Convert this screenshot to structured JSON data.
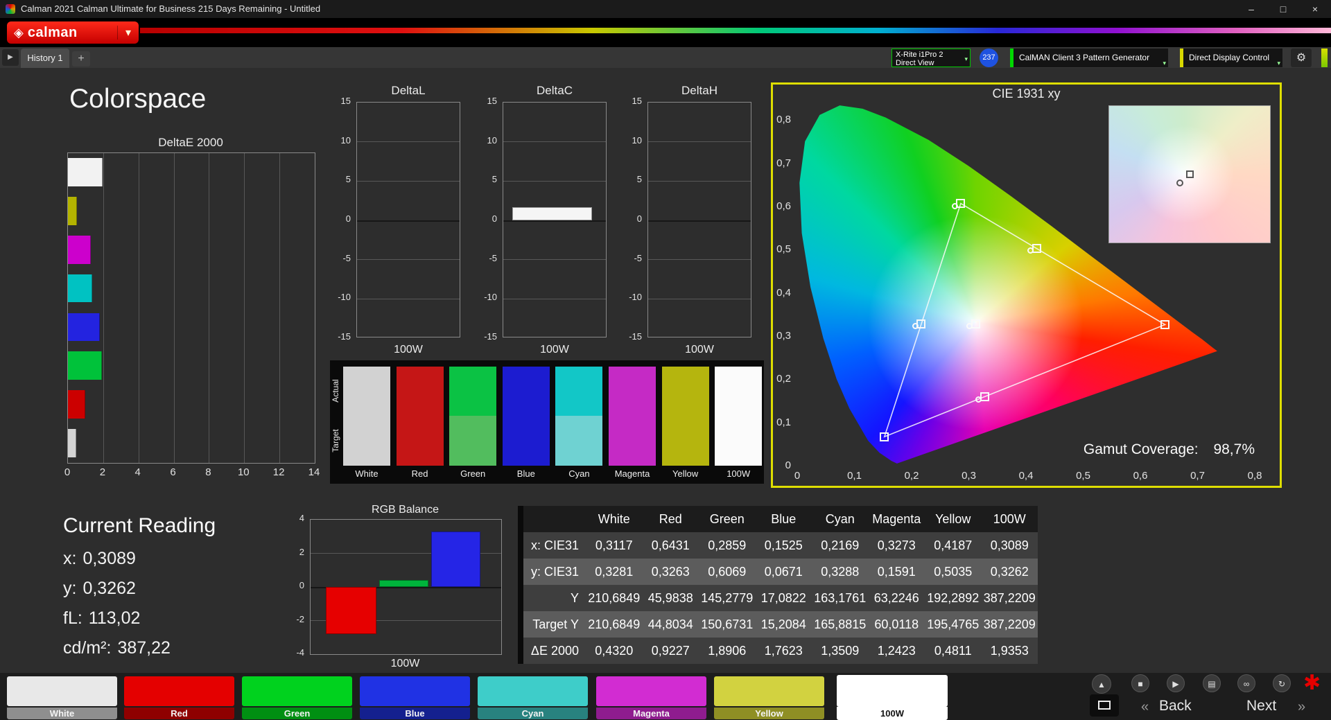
{
  "window": {
    "title": "Calman 2021 Calman Ultimate for Business 215 Days Remaining  - Untitled",
    "minimize": "–",
    "maximize": "□",
    "close": "×"
  },
  "brand": {
    "logo_text": "calman",
    "accent": "#e10600"
  },
  "tab_bar": {
    "history_tab": "History 1",
    "add_tab": "+"
  },
  "toolbar": {
    "meter_line1": "X-Rite i1Pro 2",
    "meter_line2": "Direct View",
    "badge": "237",
    "pattern_generator": "CalMAN Client 3 Pattern Generator",
    "display_control": "Direct Display Control"
  },
  "page": {
    "title": "Colorspace"
  },
  "icons": {
    "gem": "◈",
    "caret": "▾",
    "chevron": "▾",
    "gear": "⚙",
    "nav_arrow": "▶",
    "eject": "▲",
    "stop": "■",
    "play": "▶",
    "save": "▤",
    "link": "∞",
    "refresh": "↻",
    "asterisk": "✱",
    "back_chevrons": "«",
    "next_chevrons": "»"
  },
  "delta_e_chart": {
    "type": "bar",
    "title": "DeltaE 2000",
    "xlim": [
      0,
      14
    ],
    "xticks": [
      "0",
      "2",
      "4",
      "6",
      "8",
      "10",
      "12",
      "14"
    ],
    "bars": [
      {
        "name": "100W",
        "color": "#f2f2f2",
        "value": 1.9353
      },
      {
        "name": "Yellow",
        "color": "#b3b300",
        "value": 0.4811
      },
      {
        "name": "Magenta",
        "color": "#cc00cc",
        "value": 1.2423
      },
      {
        "name": "Cyan",
        "color": "#00c2c2",
        "value": 1.3509
      },
      {
        "name": "Blue",
        "color": "#2323e0",
        "value": 1.7623
      },
      {
        "name": "Green",
        "color": "#00c23a",
        "value": 1.8906
      },
      {
        "name": "Red",
        "color": "#cc0000",
        "value": 0.9227
      },
      {
        "name": "White",
        "color": "#d4d4d4",
        "value": 0.432
      }
    ]
  },
  "delta_charts": {
    "ylim": [
      -15,
      15
    ],
    "yticks": [
      "15",
      "10",
      "5",
      "0",
      "-5",
      "-10",
      "-15"
    ],
    "xlabel": "100W",
    "charts": [
      {
        "title": "DeltaL",
        "value": 0
      },
      {
        "title": "DeltaC",
        "value": 1.7
      },
      {
        "title": "DeltaH",
        "value": 0
      }
    ]
  },
  "swatch_compare": {
    "row_labels": [
      "Actual",
      "Target"
    ],
    "columns": [
      {
        "label": "White",
        "actual": "#d2d2d2",
        "target": "#d2d2d2"
      },
      {
        "label": "Red",
        "actual": "#c51616",
        "target": "#c51616"
      },
      {
        "label": "Green",
        "actual": "#0bc244",
        "target": "#52bd5e"
      },
      {
        "label": "Blue",
        "actual": "#1c1cd0",
        "target": "#1c1cd0"
      },
      {
        "label": "Cyan",
        "actual": "#12c7c7",
        "target": "#6fd2d2"
      },
      {
        "label": "Magenta",
        "actual": "#c52ac5",
        "target": "#c52ac5"
      },
      {
        "label": "Yellow",
        "actual": "#b5b50e",
        "target": "#b5b50e"
      },
      {
        "label": "100W",
        "actual": "#fbfbfb",
        "target": "#fbfbfb"
      }
    ]
  },
  "cie_chart": {
    "title": "CIE 1931 xy",
    "xticks": [
      "0",
      "0,1",
      "0,2",
      "0,3",
      "0,4",
      "0,5",
      "0,6",
      "0,7",
      "0,8"
    ],
    "yticks": [
      "0,8",
      "0,7",
      "0,6",
      "0,5",
      "0,4",
      "0,3",
      "0,2",
      "0,1",
      "0"
    ],
    "gamut_label": "Gamut Coverage:",
    "gamut_value": "98,7%",
    "points": [
      {
        "name": "white",
        "x": 0.3117,
        "y": 0.3281,
        "circle": true
      },
      {
        "name": "red",
        "x": 0.6431,
        "y": 0.3263,
        "circle": false
      },
      {
        "name": "green",
        "x": 0.2859,
        "y": 0.6069,
        "circle": true
      },
      {
        "name": "blue",
        "x": 0.1525,
        "y": 0.0671,
        "circle": false
      },
      {
        "name": "cyan",
        "x": 0.2169,
        "y": 0.3288,
        "circle": true
      },
      {
        "name": "magenta",
        "x": 0.3273,
        "y": 0.1591,
        "circle": true
      },
      {
        "name": "yellow",
        "x": 0.4187,
        "y": 0.5035,
        "circle": true
      }
    ],
    "triangle": [
      "red",
      "green",
      "blue"
    ]
  },
  "current_reading": {
    "title": "Current Reading",
    "lines": [
      {
        "label": "x:",
        "value": "0,3089"
      },
      {
        "label": "y:",
        "value": "0,3262"
      },
      {
        "label": "fL:",
        "value": "113,02"
      },
      {
        "label": "cd/m²:",
        "value": "387,22"
      }
    ]
  },
  "rgb_balance": {
    "type": "bar",
    "title": "RGB Balance",
    "ylim": [
      -4,
      4
    ],
    "yticks": [
      "4",
      "2",
      "0",
      "-2",
      "-4"
    ],
    "xlabel": "100W",
    "bars": [
      {
        "name": "red",
        "color": "#e60000",
        "value": -2.8
      },
      {
        "name": "green",
        "color": "#00b43c",
        "value": 0.4
      },
      {
        "name": "blue",
        "color": "#2525e6",
        "value": 3.3
      }
    ]
  },
  "measurement_table": {
    "columns": [
      "White",
      "Red",
      "Green",
      "Blue",
      "Cyan",
      "Magenta",
      "Yellow",
      "100W"
    ],
    "rows": [
      {
        "label": "x: CIE31",
        "values": [
          "0,3117",
          "0,6431",
          "0,2859",
          "0,1525",
          "0,2169",
          "0,3273",
          "0,4187",
          "0,3089"
        ]
      },
      {
        "label": "y: CIE31",
        "values": [
          "0,3281",
          "0,3263",
          "0,6069",
          "0,0671",
          "0,3288",
          "0,1591",
          "0,5035",
          "0,3262"
        ]
      },
      {
        "label": "Y",
        "values": [
          "210,6849",
          "45,9838",
          "145,2779",
          "17,0822",
          "163,1761",
          "63,2246",
          "192,2892",
          "387,2209"
        ]
      },
      {
        "label": "Target Y",
        "values": [
          "210,6849",
          "44,8034",
          "150,6731",
          "15,2084",
          "165,8815",
          "60,0118",
          "195,4765",
          "387,2209"
        ]
      },
      {
        "label": "ΔE 2000",
        "values": [
          "0,4320",
          "0,9227",
          "1,8906",
          "1,7623",
          "1,3509",
          "1,2423",
          "0,4811",
          "1,9353"
        ]
      }
    ]
  },
  "bottom_bar": {
    "patterns": [
      {
        "label": "White",
        "color": "#e8e8e8",
        "label_bg": "#8f8f8f",
        "selected": false
      },
      {
        "label": "Red",
        "color": "#e40000",
        "label_bg": "#8f0000",
        "selected": false
      },
      {
        "label": "Green",
        "color": "#00d21e",
        "label_bg": "#008f12",
        "selected": false
      },
      {
        "label": "Blue",
        "color": "#2032e4",
        "label_bg": "#14208f",
        "selected": false
      },
      {
        "label": "Cyan",
        "color": "#3ecdc9",
        "label_bg": "#28827f",
        "selected": false
      },
      {
        "label": "Magenta",
        "color": "#d22cd2",
        "label_bg": "#8f1c8f",
        "selected": false
      },
      {
        "label": "Yellow",
        "color": "#d2d240",
        "label_bg": "#8f8f24",
        "selected": false
      },
      {
        "label": "100W",
        "color": "#ffffff",
        "label_bg": "#ffffff",
        "selected": true
      }
    ],
    "back_label": "Back",
    "next_label": "Next"
  }
}
